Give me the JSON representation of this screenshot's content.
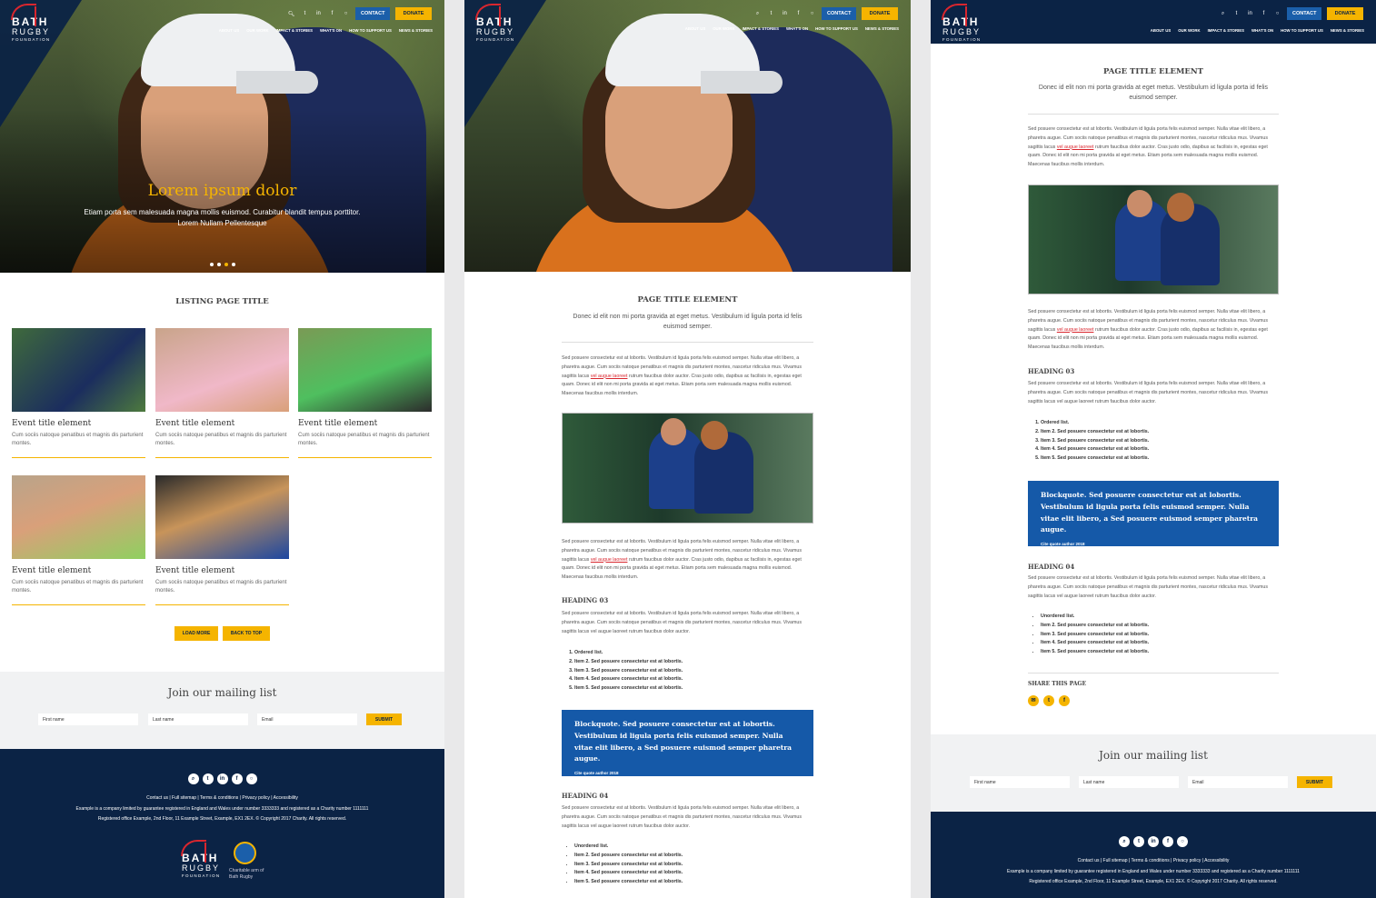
{
  "brand": {
    "line1": "BATH",
    "line2": "RUGBY",
    "line3": "FOUNDATION"
  },
  "header": {
    "contact_label": "CONTACT",
    "donate_label": "DONATE",
    "nav": [
      "ABOUT US",
      "OUR WORK",
      "IMPACT & STORIES",
      "WHAT'S ON",
      "HOW TO SUPPORT US",
      "NEWS & STORIES"
    ],
    "tool_icons": [
      "search-icon",
      "twitter-icon",
      "linkedin-icon",
      "facebook-icon",
      "instagram-icon"
    ]
  },
  "hero": {
    "title": "Lorem ipsum dolor",
    "text": "Etiam porta sem malesuada magna mollis euismod. Curabitur blandit tempus porttitor. Lorem Nullam Pellentesque",
    "dots": 4,
    "active_dot": 2
  },
  "listing": {
    "title": "LISTING PAGE TITLE",
    "cards": [
      {
        "title": "Event title element",
        "desc": "Cum sociis natoque penatibus et magnis dis parturient montes."
      },
      {
        "title": "Event title element",
        "desc": "Cum sociis natoque penatibus et magnis dis parturient montes."
      },
      {
        "title": "Event title element",
        "desc": "Cum sociis natoque penatibus et magnis dis parturient montes."
      },
      {
        "title": "Event title element",
        "desc": "Cum sociis natoque penatibus et magnis dis parturient montes."
      },
      {
        "title": "Event title element",
        "desc": "Cum sociis natoque penatibus et magnis dis parturient montes."
      }
    ],
    "load_more": "LOAD MORE",
    "back_to_top": "BACK TO TOP"
  },
  "mailing": {
    "title": "Join our mailing list",
    "first_name": "First name",
    "last_name": "Last name",
    "email": "Email",
    "submit": "SUBMIT"
  },
  "footer": {
    "links": "Contact us | Full sitemap | Terms & conditions | Privacy policy | Accessibility",
    "company": "Example is a company limited by guarantee registered in England and Wales under number 3333333 and registered as a Charity number 1111111",
    "office": "Registered office Example, 2nd Floor, 11 Example Street, Example, EX1 2EX. © Copyright 2017 Charity. All rights reserved.",
    "charitable": "Charitable arm of Bath Rugby",
    "social_icons": [
      "search-icon",
      "twitter-icon",
      "linkedin-icon",
      "facebook-icon",
      "instagram-icon"
    ]
  },
  "article": {
    "title": "PAGE TITLE ELEMENT",
    "subtitle": "Donec id elit non mi porta gravida at eget metus. Vestibulum id ligula porta id felis euismod semper.",
    "para_a": "Sed posuere consectetur est at lobortis. Vestibulum id ligula porta felis euismod semper. Nulla vitae elit libero, a pharetra augue. Cum sociis natoque penatibus et magnis dis parturient montes, nascetur ridiculus mus. Vivamus sagittis lacus",
    "para_link": "vel augue laoreet",
    "para_b": "rutrum faucibus dolor auctor. Cras justo odio, dapibus ac facilisis in, egestas eget quam. Donec id elit non mi porta gravida at eget metus. Etiam porta sem malesuada magna mollis euismod. Maecenas faucibus mollis interdum.",
    "heading3": "HEADING 03",
    "para_short": "Sed posuere consectetur est at lobortis. Vestibulum id ligula porta felis euismod semper. Nulla vitae elit libero, a pharetra augue. Cum sociis natoque penatibus et magnis dis parturient montes, nascetur ridiculus mus. Vivamus sagittis lacus vel augue laoreet rutrum faucibus dolor auctor.",
    "ordered": [
      "Ordered list.",
      "Item 2. Sed posuere consectetur est at lobortis.",
      "Item 3. Sed posuere consectetur est at lobortis.",
      "Item 4. Sed posuere consectetur est at lobortis.",
      "Item 5. Sed posuere consectetur est at lobortis."
    ],
    "blockquote": "Blockquote. Sed posuere consectetur est at lobortis. Vestibulum id ligula porta felis euismod semper. Nulla vitae elit libero, a Sed posuere euismod semper pharetra augue.",
    "cite": "Cite quote author 2018",
    "heading4": "HEADING 04",
    "unordered": [
      "Unordered list.",
      "Item 2. Sed posuere consectetur est at lobortis.",
      "Item 3. Sed posuere consectetur est at lobortis.",
      "Item 4. Sed posuere consectetur est at lobortis.",
      "Item 5. Sed posuere consectetur est at lobortis."
    ],
    "share_title": "SHARE THIS PAGE",
    "share_icons": [
      "email-icon",
      "twitter-icon",
      "facebook-icon"
    ]
  }
}
